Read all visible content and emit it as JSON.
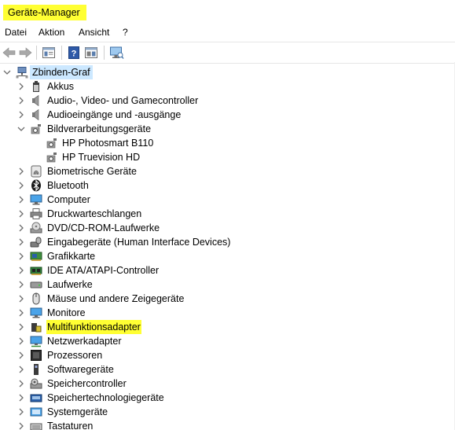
{
  "window": {
    "title": "Geräte-Manager"
  },
  "menu": [
    {
      "id": "datei",
      "label": "Datei"
    },
    {
      "id": "aktion",
      "label": "Aktion"
    },
    {
      "id": "ansicht",
      "label": "Ansicht"
    },
    {
      "id": "hilfe",
      "label": "?"
    }
  ],
  "toolbar": {
    "buttons": [
      "back-arrow-icon",
      "forward-arrow-icon",
      "properties-icon",
      "help-icon",
      "driver-update-icon",
      "scan-hardware-icon"
    ]
  },
  "tree": {
    "root": {
      "label": "Zbinden-Graf",
      "icon": "computer-network-icon",
      "expanded": true
    },
    "categories": [
      {
        "label": "Akkus",
        "icon": "battery-icon",
        "expanded": false
      },
      {
        "label": "Audio-, Video- und Gamecontroller",
        "icon": "speaker-icon",
        "expanded": false
      },
      {
        "label": "Audioeingänge und -ausgänge",
        "icon": "speaker-icon",
        "expanded": false
      },
      {
        "label": "Bildverarbeitungsgeräte",
        "icon": "camera-icon",
        "expanded": true,
        "children": [
          {
            "label": "HP Photosmart B110",
            "icon": "camera-icon"
          },
          {
            "label": "HP Truevision HD",
            "icon": "camera-icon"
          }
        ]
      },
      {
        "label": "Biometrische Geräte",
        "icon": "fingerprint-icon",
        "expanded": false
      },
      {
        "label": "Bluetooth",
        "icon": "bluetooth-icon",
        "expanded": false
      },
      {
        "label": "Computer",
        "icon": "monitor-icon",
        "expanded": false
      },
      {
        "label": "Druckwarteschlangen",
        "icon": "printer-icon",
        "expanded": false
      },
      {
        "label": "DVD/CD-ROM-Laufwerke",
        "icon": "disc-drive-icon",
        "expanded": false
      },
      {
        "label": "Eingabegeräte (Human Interface Devices)",
        "icon": "hid-icon",
        "expanded": false
      },
      {
        "label": "Grafikkarte",
        "icon": "display-adapter-icon",
        "expanded": false
      },
      {
        "label": "IDE ATA/ATAPI-Controller",
        "icon": "ide-controller-icon",
        "expanded": false
      },
      {
        "label": "Laufwerke",
        "icon": "hard-drive-icon",
        "expanded": false
      },
      {
        "label": "Mäuse und andere Zeigegeräte",
        "icon": "mouse-icon",
        "expanded": false
      },
      {
        "label": "Monitore",
        "icon": "monitor-icon",
        "expanded": false
      },
      {
        "label": "Multifunktionsadapter",
        "icon": "multifunction-icon",
        "expanded": false,
        "highlighted": true
      },
      {
        "label": "Netzwerkadapter",
        "icon": "network-adapter-icon",
        "expanded": false
      },
      {
        "label": "Prozessoren",
        "icon": "cpu-icon",
        "expanded": false
      },
      {
        "label": "Softwaregeräte",
        "icon": "software-device-icon",
        "expanded": false
      },
      {
        "label": "Speichercontroller",
        "icon": "storage-controller-icon",
        "expanded": false
      },
      {
        "label": "Speichertechnologiegeräte",
        "icon": "memory-tech-icon",
        "expanded": false
      },
      {
        "label": "Systemgeräte",
        "icon": "system-devices-icon",
        "expanded": false
      },
      {
        "label": "Tastaturen",
        "icon": "keyboard-icon",
        "expanded": false
      }
    ]
  },
  "colors": {
    "highlight": "#ffff33",
    "root_selection": "#cce8ff",
    "chevron": "#6d6d6d"
  }
}
